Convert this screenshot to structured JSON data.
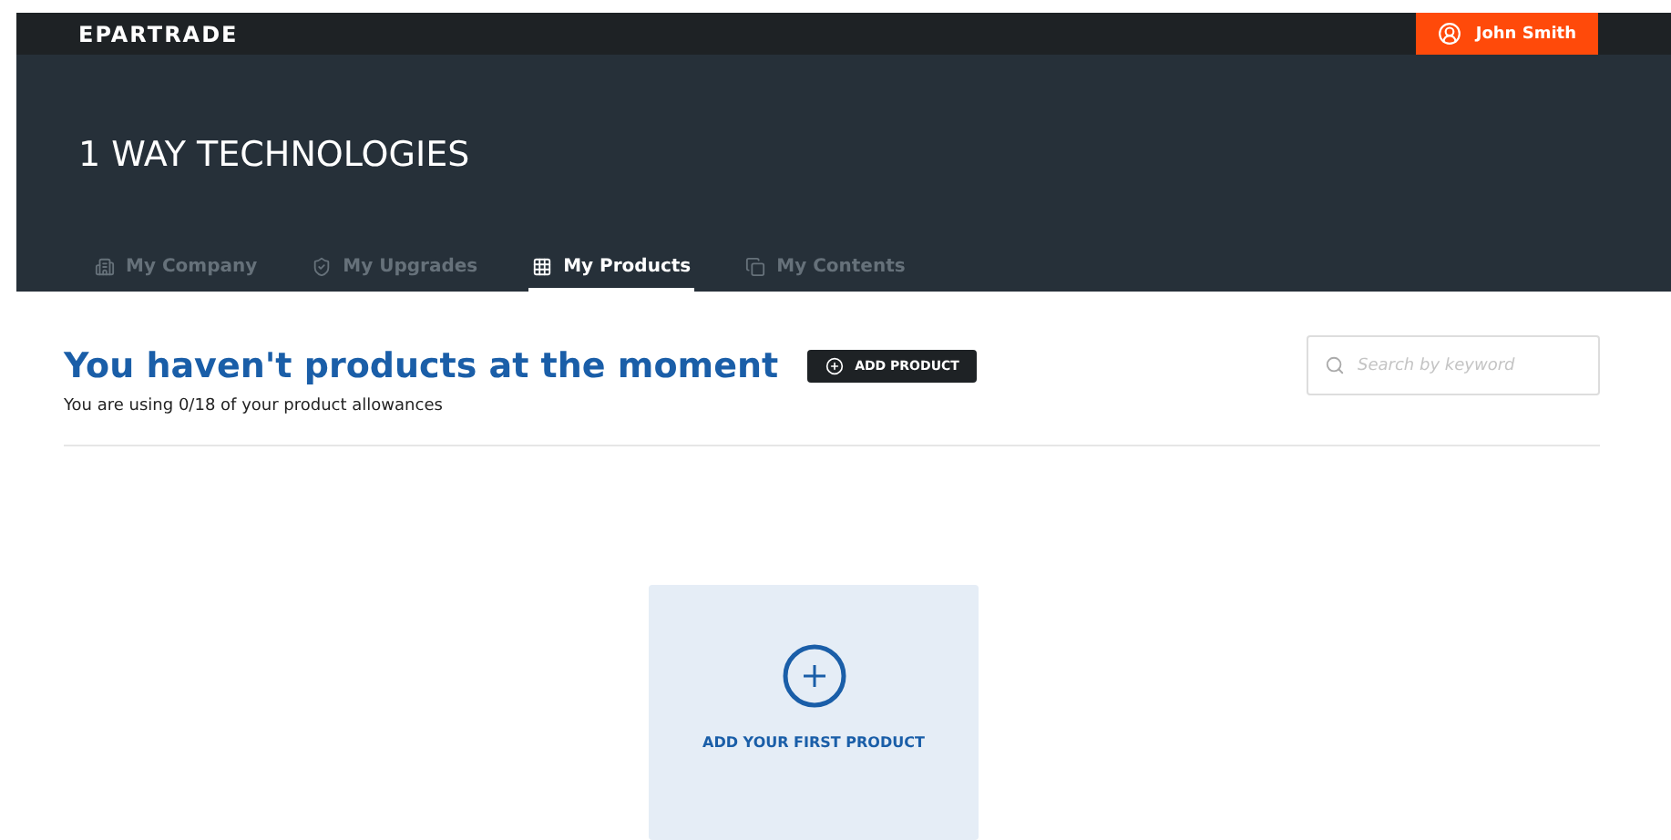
{
  "header": {
    "logo": "EPARTRADE",
    "user": "John Smith"
  },
  "company": {
    "name": "1 WAY TECHNOLOGIES"
  },
  "tabs": [
    {
      "label": "My Company",
      "selected": false
    },
    {
      "label": "My Upgrades",
      "selected": false
    },
    {
      "label": "My Products",
      "selected": true
    },
    {
      "label": "My Contents",
      "selected": false
    }
  ],
  "content": {
    "heading": "You haven't products at the moment",
    "add_button": "ADD PRODUCT",
    "allowance": "You are using 0/18 of your product allowances",
    "search": {
      "placeholder": "Search by keyword"
    },
    "empty_card": "ADD YOUR FIRST PRODUCT"
  }
}
